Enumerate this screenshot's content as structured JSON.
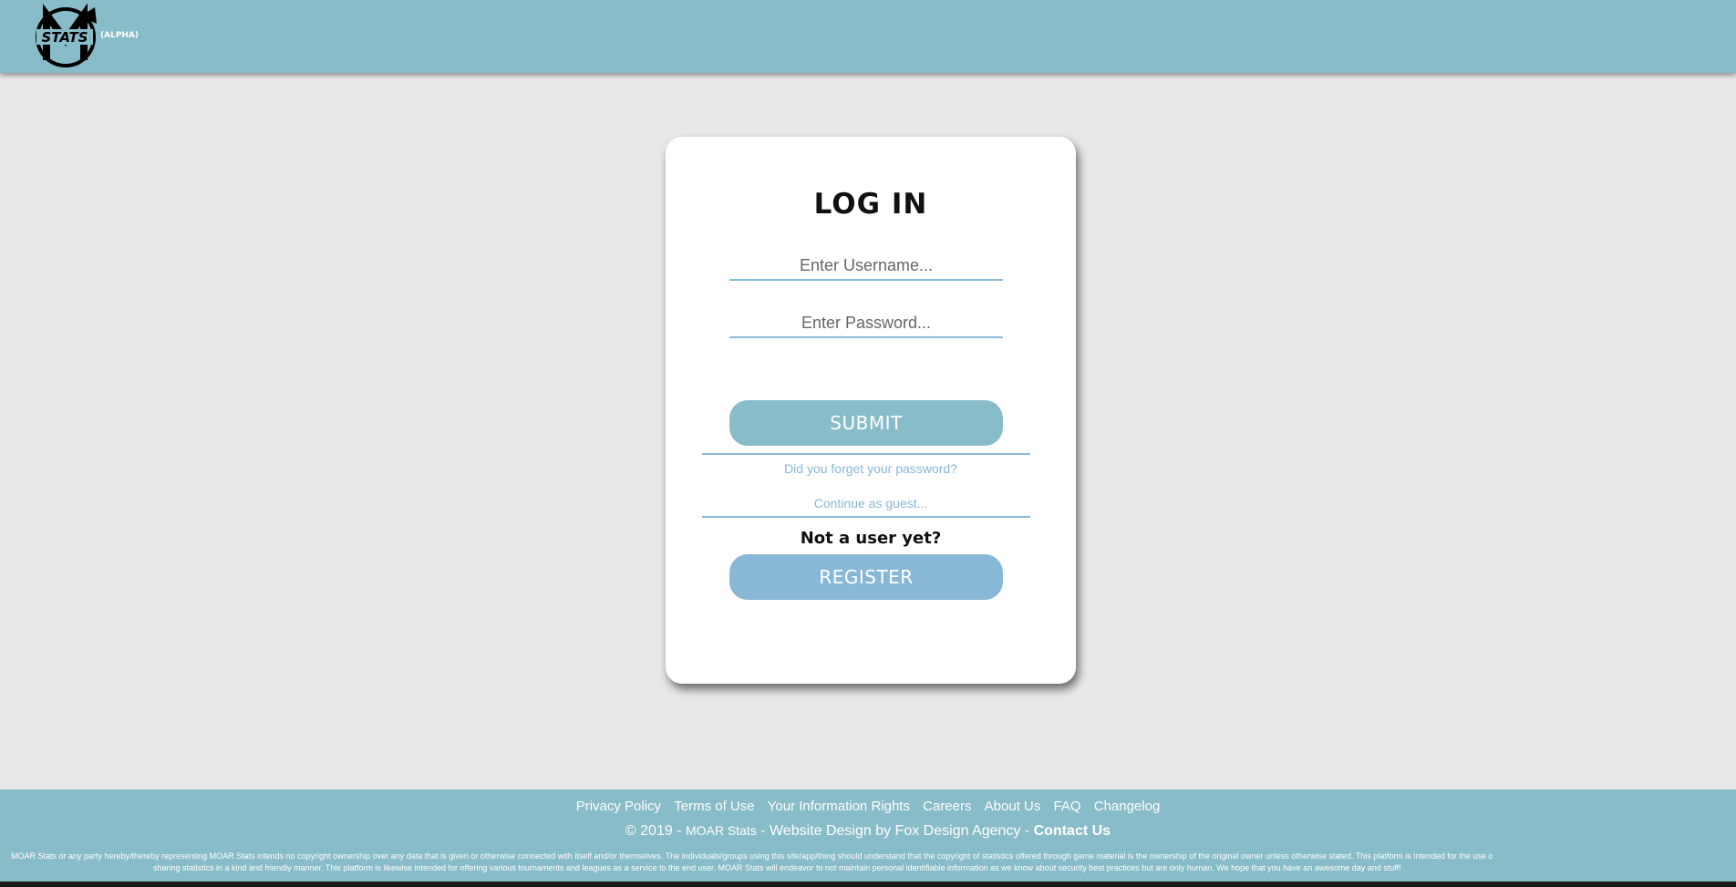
{
  "header": {
    "logo": {
      "icon": "moar-stats-logo",
      "text": "STATS",
      "tag": "(ALPHA)"
    }
  },
  "login": {
    "title": "LOG IN",
    "username_placeholder": "Enter Username...",
    "password_placeholder": "Enter Password...",
    "submit_label": "SUBMIT",
    "forgot_label": "Did you forget your password?",
    "guest_label": "Continue as guest...",
    "not_user_label": "Not a user yet?",
    "register_label": "REGISTER"
  },
  "footer": {
    "links": [
      "Privacy Policy",
      "Terms of Use",
      "Your Information Rights",
      "Careers",
      "About Us",
      "FAQ",
      "Changelog"
    ],
    "copyright_prefix": "© 2019 -",
    "brand": "MOAR Stats",
    "copyright_mid": "- Website Design by Fox Design Agency -",
    "contact_label": "Contact Us",
    "disclaimer_line1": "MOAR Stats or any party hereby/thereby representing MOAR Stats intends no copyright ownership over any data that is given or otherwise connected with itself and/or themselves. The individuals/groups using this site/app/thing should understand that the copyright of statistics offered through game material is the ownership of the original owner unless otherwise stated. This platform is intended for the use o",
    "disclaimer_line2": "sharing statistics in a kind and friendly manner. This platform is likewise intended for offering various tournaments and leagues as a service to the end user. MOAR Stats will endeavor to not maintain personal identifiable information as we know about security best practices but are only human. We hope that you have an awesome day and stuff!"
  },
  "colors": {
    "header_bg": "#88bcc8",
    "page_bg": "#e8e8e8",
    "accent": "#88b8d6",
    "card_bg": "#ffffff"
  }
}
